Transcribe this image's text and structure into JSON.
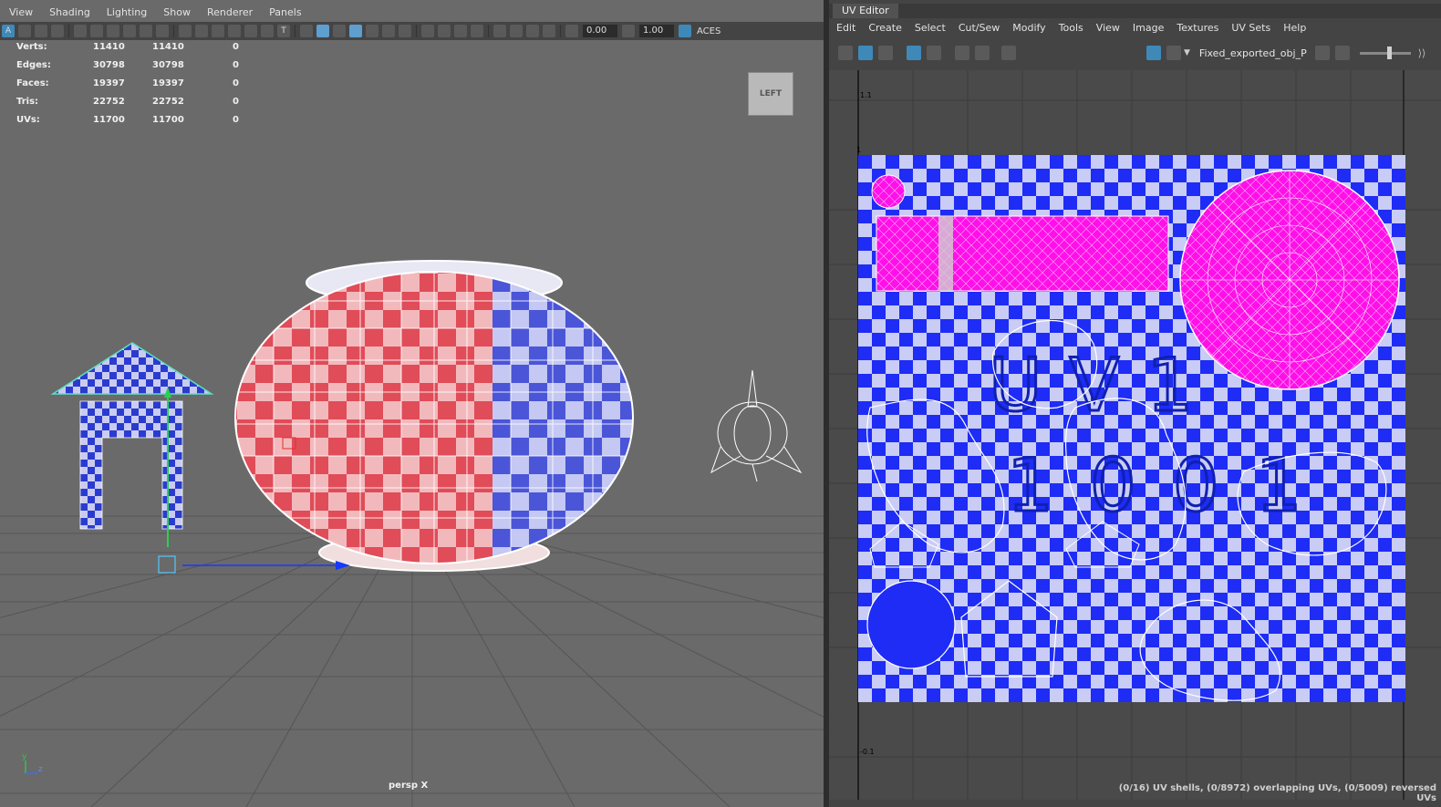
{
  "viewport": {
    "menu": [
      "View",
      "Shading",
      "Lighting",
      "Show",
      "Renderer",
      "Panels"
    ],
    "toolbar": {
      "exposure_value": "0.00",
      "gamma_value": "1.00",
      "color_space": "ACES"
    },
    "stats": [
      {
        "label": "Verts:",
        "a": "11410",
        "b": "11410",
        "c": "0"
      },
      {
        "label": "Edges:",
        "a": "30798",
        "b": "30798",
        "c": "0"
      },
      {
        "label": "Faces:",
        "a": "19397",
        "b": "19397",
        "c": "0"
      },
      {
        "label": "Tris:",
        "a": "22752",
        "b": "22752",
        "c": "0"
      },
      {
        "label": "UVs:",
        "a": "11700",
        "b": "11700",
        "c": "0"
      }
    ],
    "viewcube_label": "LEFT",
    "camera_label": "persp X",
    "axis_y": "y",
    "axis_z": "z"
  },
  "uv_editor": {
    "title": "UV Editor",
    "menu": [
      "Edit",
      "Create",
      "Select",
      "Cut/Sew",
      "Modify",
      "Tools",
      "View",
      "Image",
      "Textures",
      "UV Sets",
      "Help"
    ],
    "texture_name": "Fixed_exported_obj_P",
    "tick_labels": {
      "top": "1.1",
      "one": "1",
      "bottom": "-0.1"
    },
    "tile_label_top": "UV1",
    "tile_label_bottom": "1001",
    "status": "(0/16) UV shells, (0/8972) overlapping UVs, (0/5009) reversed UVs"
  },
  "colors": {
    "viewport_bg": "#6a6a6a",
    "panel_bg": "#444444",
    "checker_red": "#e04c58",
    "checker_blue": "#4a55d8",
    "uv_magenta": "#ff10e8",
    "uv_blue": "#1e2cf5",
    "accent": "#3f89b8"
  }
}
